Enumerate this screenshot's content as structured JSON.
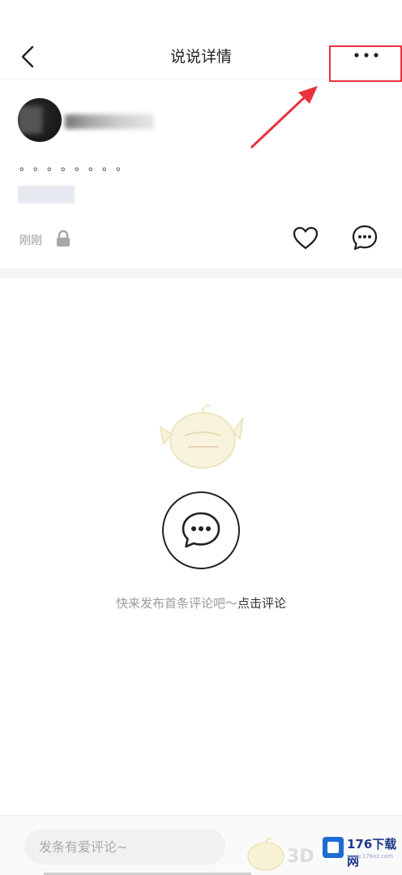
{
  "header": {
    "title": "说说详情",
    "back_icon": "chevron-left-icon",
    "more_icon": "more-horizontal-icon"
  },
  "post": {
    "text": "。。。。。。。。",
    "time": "刚刚",
    "lock_icon": "lock-icon",
    "like_icon": "heart-icon",
    "comment_icon": "comment-icon"
  },
  "empty_state": {
    "text": "快来发布首条评论吧～",
    "link": "点击评论"
  },
  "comment_bar": {
    "placeholder": "发条有爱评论~"
  },
  "watermark": {
    "brand": "176下载网",
    "url": "www.176xz.com",
    "extra": "3D"
  },
  "colors": {
    "annotation_red": "#e8323c",
    "muted_text": "#9a9a9a"
  }
}
